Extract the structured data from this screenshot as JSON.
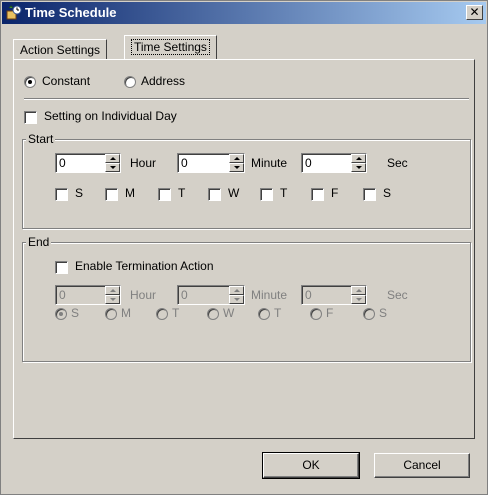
{
  "window": {
    "title": "Time Schedule",
    "close": "✕"
  },
  "tabs": [
    {
      "label": "Action Settings",
      "active": false
    },
    {
      "label": "Time Settings",
      "active": true
    }
  ],
  "mode": {
    "constant": "Constant",
    "address": "Address",
    "selected": "Constant"
  },
  "individual_day": {
    "label": "Setting on Individual Day",
    "checked": false
  },
  "start": {
    "legend": "Start",
    "hour": {
      "value": "0",
      "unit": "Hour"
    },
    "minute": {
      "value": "0",
      "unit": "Minute"
    },
    "sec": {
      "value": "0",
      "unit": "Sec"
    },
    "days": [
      "S",
      "M",
      "T",
      "W",
      "T",
      "F",
      "S"
    ]
  },
  "end": {
    "legend": "End",
    "enable_label": "Enable Termination Action",
    "enable_checked": false,
    "hour": {
      "value": "0",
      "unit": "Hour"
    },
    "minute": {
      "value": "0",
      "unit": "Minute"
    },
    "sec": {
      "value": "0",
      "unit": "Sec"
    },
    "days": [
      "S",
      "M",
      "T",
      "W",
      "T",
      "F",
      "S"
    ],
    "selected_day_index": 0
  },
  "buttons": {
    "ok": "OK",
    "cancel": "Cancel"
  },
  "colors": {
    "titlebar_start": "#0a246a",
    "titlebar_end": "#a6caf0",
    "face": "#d4d0c8"
  }
}
